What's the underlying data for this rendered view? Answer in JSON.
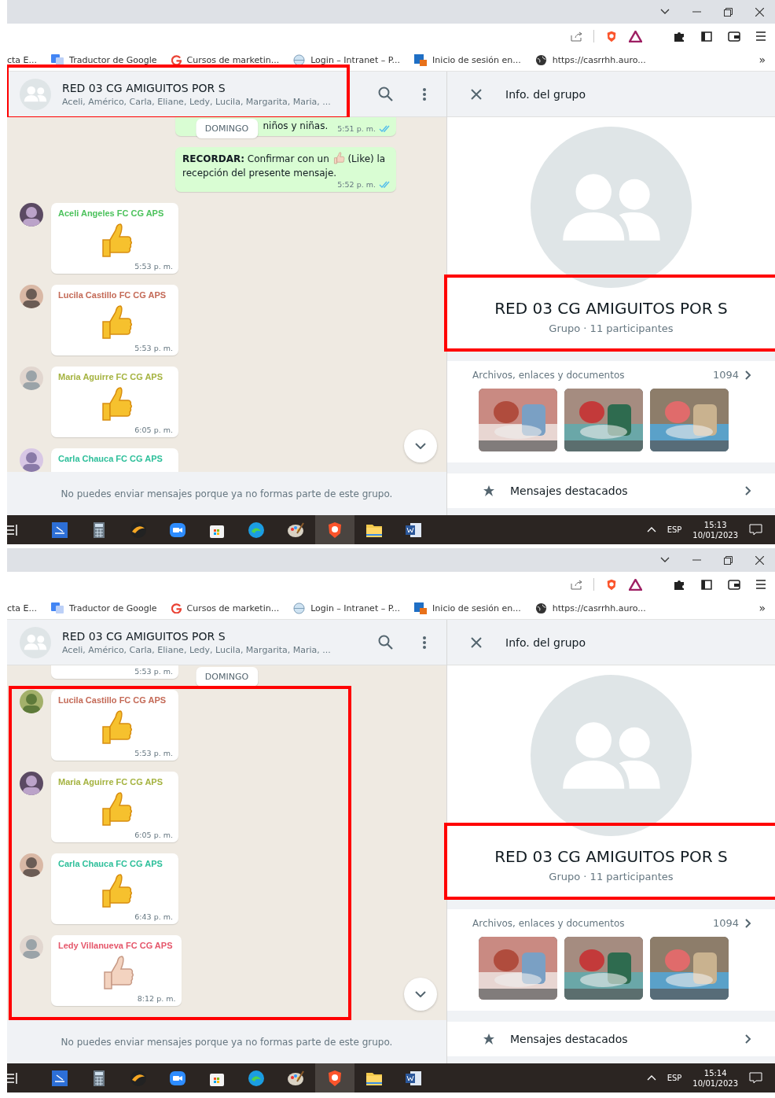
{
  "screens": [
    {
      "bookmarks": [
        {
          "label": "cta E..."
        },
        {
          "label": "Traductor de Google"
        },
        {
          "label": "Cursos de marketin..."
        },
        {
          "label": "Login – Intranet – P..."
        },
        {
          "label": "Inicio de sesión en..."
        },
        {
          "label": "https://casrrhh.auro..."
        }
      ],
      "bookmarks_more": "»",
      "chat": {
        "title": "RED 03 CG AMIGUITOS POR S",
        "subtitle": "Aceli, Américo, Carla, Eliane, Ledy, Lucila, Margarita, Maria, ...",
        "header_highlighted": true,
        "list_highlighted": false,
        "messages": [
          {
            "kind": "tail_out",
            "text": "niños y niñas.",
            "time": "5:51 p. m.",
            "read": true,
            "date_chip": "DOMINGO"
          },
          {
            "kind": "outgoing",
            "before": "**RECORDAR:** Confirmar con un",
            "after": "(Like) la recepción del presente mensaje.",
            "time": "5:52 p. m.",
            "read": true
          },
          {
            "kind": "sticker",
            "sender": "Aceli Angeles FC CG APS",
            "color": "#4cc25c",
            "time": "5:53 p. m."
          },
          {
            "kind": "sticker",
            "sender": "Lucila Castillo FC CG APS",
            "color": "#c46a57",
            "time": "5:53 p. m."
          },
          {
            "kind": "sticker",
            "sender": "Maria Aguirre FC CG APS",
            "color": "#a5b340",
            "time": "6:05 p. m."
          },
          {
            "kind": "sticker",
            "sender": "Carla Chauca FC CG APS",
            "color": "#2dbf9a"
          }
        ],
        "footer_note": "No puedes enviar mensajes porque ya no formas parte de este grupo."
      },
      "info": {
        "header": "Info. del grupo",
        "name": "RED 03 CG AMIGUITOS POR S",
        "meta": "Grupo · 11 participantes",
        "name_highlighted": true,
        "files_label": "Archivos, enlaces y documentos",
        "files_count": "1094",
        "starred": "Mensajes destacados"
      },
      "taskbar": {
        "lang": "ESP",
        "time": "15:13",
        "date": "10/01/2023"
      }
    },
    {
      "bookmarks": [
        {
          "label": "cta E..."
        },
        {
          "label": "Traductor de Google"
        },
        {
          "label": "Cursos de marketin..."
        },
        {
          "label": "Login – Intranet – P..."
        },
        {
          "label": "Inicio de sesión en..."
        },
        {
          "label": "https://casrrhh.auro..."
        }
      ],
      "bookmarks_more": "»",
      "chat": {
        "title": "RED 03 CG AMIGUITOS POR S",
        "subtitle": "Aceli, Américo, Carla, Eliane, Ledy, Lucila, Margarita, Maria, ...",
        "header_highlighted": false,
        "list_highlighted": true,
        "messages": [
          {
            "kind": "tail_in",
            "time": "5:53 p. m.",
            "read": false,
            "date_chip": "DOMINGO"
          },
          {
            "kind": "sticker",
            "sender": "Lucila Castillo FC CG APS",
            "color": "#c46a57",
            "time": "5:53 p. m."
          },
          {
            "kind": "sticker",
            "sender": "Maria Aguirre FC CG APS",
            "color": "#a5b340",
            "time": "6:05 p. m."
          },
          {
            "kind": "sticker",
            "sender": "Carla Chauca FC CG APS",
            "color": "#2dbf9a",
            "time": "6:43 p. m."
          },
          {
            "kind": "sticker_light",
            "sender": "Ledy Villanueva FC CG APS",
            "color": "#e5566a",
            "time": "8:12 p. m."
          }
        ],
        "footer_note": "No puedes enviar mensajes porque ya no formas parte de este grupo."
      },
      "info": {
        "header": "Info. del grupo",
        "name": "RED 03 CG AMIGUITOS POR S",
        "meta": "Grupo · 11 participantes",
        "name_highlighted": true,
        "files_label": "Archivos, enlaces y documentos",
        "files_count": "1094",
        "starred": "Mensajes destacados"
      },
      "taskbar": {
        "lang": "ESP",
        "time": "15:14",
        "date": "10/01/2023"
      }
    }
  ]
}
